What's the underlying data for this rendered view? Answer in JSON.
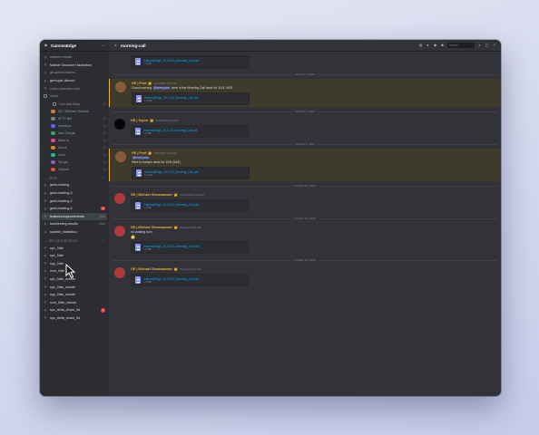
{
  "window": {
    "server_name": "GammaEdge",
    "channel_title": "morning-call"
  },
  "sidebar": {
    "top_items": [
      {
        "icon": "hash",
        "label": "market-mosaic",
        "count": ""
      },
      {
        "icon": "hash",
        "label": "Market Structure Hackathon",
        "count": "",
        "strong": true
      },
      {
        "icon": "hash",
        "label": "ge-active-traders",
        "count": ""
      },
      {
        "icon": "hash",
        "label": "gerhogel-discord",
        "count": "",
        "strong": true
      },
      {
        "icon": "hash",
        "label": "voice-channels chat",
        "count": ""
      },
      {
        "icon": "speaker",
        "label": "Voice",
        "count": ""
      },
      {
        "icon": "speaker",
        "label": "Live and Slow",
        "count": "2",
        "sub": true
      }
    ],
    "members": [
      {
        "name": "GE | Michael Shanks",
        "color": "#c4803a",
        "count": ""
      },
      {
        "name": "ATTP Nel",
        "color": "#7a7f8a",
        "count": "2"
      },
      {
        "name": "peelaquo",
        "color": "#5865f2",
        "count": "1"
      },
      {
        "name": "Max Giorgio",
        "color": "#3ba55d",
        "count": "2"
      },
      {
        "name": "Beau is",
        "color": "#eb459e",
        "count": "1"
      },
      {
        "name": "Nurnz",
        "color": "#e67e22",
        "count": "2"
      },
      {
        "name": "Doze",
        "color": "#1abc9c",
        "count": "1"
      },
      {
        "name": "Ola gin",
        "color": "#9b59b6",
        "count": "1"
      },
      {
        "name": "dSpook",
        "color": "#e74c3c",
        "count": "1"
      }
    ],
    "categories": [
      {
        "label": "Edge",
        "channels": [
          {
            "label": "gest-charting",
            "badge": ""
          },
          {
            "label": "gest-charting-3",
            "badge": ""
          },
          {
            "label": "gest-charting-2",
            "badge": ""
          },
          {
            "label": "gest-charting-4",
            "badge": "1"
          },
          {
            "label": "features-improvements",
            "badge": "",
            "selected": true,
            "note": "New"
          },
          {
            "label": "backtesting-results",
            "badge": "",
            "note": "New"
          },
          {
            "label": "sparkle_statistics-r",
            "badge": ""
          }
        ]
      },
      {
        "label": "spx-ss-statistics",
        "channels": [
          {
            "label": "spx_3dte",
            "badge": ""
          },
          {
            "label": "spx_5dte",
            "badge": ""
          },
          {
            "label": "spy_0dte",
            "badge": ""
          },
          {
            "label": "nvm_0dte",
            "badge": ""
          },
          {
            "label": "spx_0dte_minute",
            "badge": ""
          },
          {
            "label": "spx_0dte_minute",
            "badge": ""
          },
          {
            "label": "spy_0dte_minute",
            "badge": ""
          },
          {
            "label": "nvm_0dte_minute",
            "badge": ""
          },
          {
            "label": "spx_delta_share_0d",
            "badge": "1"
          },
          {
            "label": "spx_delta_share_0d",
            "badge": ""
          }
        ]
      }
    ]
  },
  "topbar": {
    "search_placeholder": "Search"
  },
  "messages": [
    {
      "type": "attachment_only",
      "file": "GammaEdge_10-18-23_Morning_Call.pdf",
      "size": "1.4 MB"
    },
    {
      "type": "divider",
      "text": "October 3, 2023"
    },
    {
      "type": "message",
      "mention": true,
      "author": "GE | Fred",
      "badge": "👑",
      "time": "10/3/2023 9:27 AM",
      "avatar_color": "#8a5a3c",
      "text_before": "Good morning ",
      "mention_text": "@everyone",
      "text_after": " here is the Morning Call deck for 10/3, 9/03",
      "file": "GammaEdge_10-3-23_Morning_Call.pdf",
      "size": "1.5 MB"
    },
    {
      "type": "divider",
      "text": "October 4, 2023"
    },
    {
      "type": "message",
      "mention": false,
      "author": "GE | Taylor",
      "badge": "👑",
      "time": "10/4/2023 9:21 AM",
      "avatar_color": "#050505",
      "file": "GammaEdge_10-4-23_Morning_Call.pdf",
      "size": "1.2 MB"
    },
    {
      "type": "divider",
      "text": "October 5, 2023"
    },
    {
      "type": "message",
      "mention": true,
      "author": "GE | Fred",
      "badge": "👑",
      "time": "10/5/2023 9:23 AM",
      "avatar_color": "#8a5a3c",
      "text_before": "",
      "mention_text": "@everyone",
      "text_after": "",
      "text2": "Here is today's deck for 10/5 (5&5)",
      "file": "GammaEdge_10-5-23_Morning_Call.pdf",
      "size": "1.3 MB"
    },
    {
      "type": "divider",
      "text": "October 16, 2023"
    },
    {
      "type": "message",
      "mention": false,
      "author": "GE | Michael Shamsamani",
      "badge": "👑",
      "time": "10/16/2023 9:28 AM",
      "avatar_color": "#b03a3a",
      "file": "GammaEdge_10-16-23_Morning_Call.pdf",
      "size": "1.3 MB"
    },
    {
      "type": "divider",
      "text": "October 18, 2023"
    },
    {
      "type": "message",
      "mention": false,
      "author": "GE | Michael Shamsamani",
      "badge": "👑",
      "time": "Today at 9:28 AM",
      "avatar_color": "#b03a3a",
      "text_before": "no posting icon",
      "mention_text": "",
      "text_after": "",
      "emoji": "😬",
      "file": "GammaEdge_10-18-23_Morning_Call.pdf",
      "size": "1.3 MB"
    },
    {
      "type": "divider",
      "text": "October 19, 2023"
    },
    {
      "type": "message",
      "mention": false,
      "author": "GE | Michael Shamsamani",
      "badge": "👑",
      "time": "Today at 9:27 AM",
      "avatar_color": "#b03a3a",
      "file": "GammaEdge_10-19-23_Morning_Call.pdf",
      "size": "1.3 MB"
    }
  ],
  "colors": {
    "author_gold": "#f0b232",
    "mention_bg": "#3f3b2a",
    "link": "#00a8fc",
    "blurple": "#5865f2"
  }
}
